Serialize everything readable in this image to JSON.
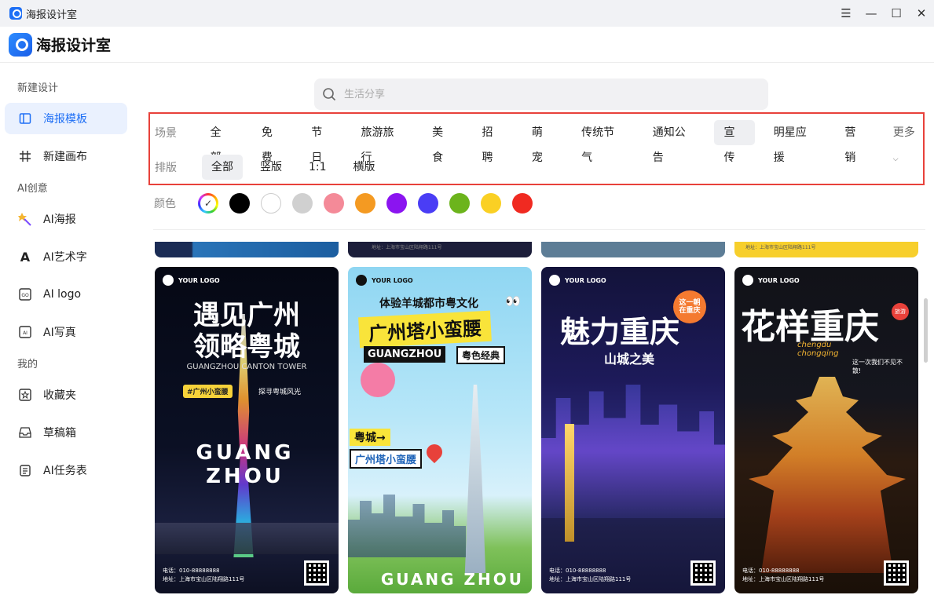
{
  "window": {
    "title": "海报设计室",
    "controls": [
      "menu-icon",
      "minimize-icon",
      "maximize-icon",
      "close-icon"
    ]
  },
  "app": {
    "title": "海报设计室"
  },
  "sidebar": {
    "sections": [
      {
        "label": "新建设计",
        "items": [
          {
            "label": "海报模板",
            "icon": "poster-template-icon",
            "active": true
          },
          {
            "label": "新建画布",
            "icon": "canvas-grid-icon",
            "active": false
          }
        ]
      },
      {
        "label": "AI创意",
        "items": [
          {
            "label": "AI海报",
            "icon": "ai-magic-wand-icon"
          },
          {
            "label": "AI艺术字",
            "icon": "ai-text-icon"
          },
          {
            "label": "AI logo",
            "icon": "ai-logo-icon"
          },
          {
            "label": "AI写真",
            "icon": "ai-portrait-icon"
          }
        ]
      },
      {
        "label": "我的",
        "items": [
          {
            "label": "收藏夹",
            "icon": "favorites-star-icon"
          },
          {
            "label": "草稿箱",
            "icon": "drafts-inbox-icon"
          },
          {
            "label": "AI任务表",
            "icon": "task-list-icon"
          }
        ]
      }
    ]
  },
  "search": {
    "placeholder": "生活分享"
  },
  "filters": {
    "scene_label": "场景",
    "scene_options": [
      "全部",
      "免费",
      "节日",
      "旅游旅行",
      "美食",
      "招聘",
      "萌宠",
      "传统节气",
      "通知公告",
      "宣传",
      "明星应援",
      "营销"
    ],
    "scene_selected": "宣传",
    "more_label": "更多",
    "layout_label": "排版",
    "layout_options": [
      "全部",
      "竖版",
      "1:1",
      "横版"
    ],
    "layout_selected": "全部",
    "color_label": "颜色",
    "colors": [
      "rainbow",
      "#000000",
      "#ffffff",
      "#d0d0d0",
      "#f48a98",
      "#f49a22",
      "#8b14f0",
      "#4a3df5",
      "#6cb41c",
      "#fad024",
      "#f02a21"
    ],
    "color_selected": "rainbow"
  },
  "posters": [
    {
      "logo": "YOUR LOGO",
      "title1": "遇见广州",
      "title2": "领略粤城",
      "subtitle": "GUANGZHOU CANTON TOWER",
      "tag": "#广州小蛮腰",
      "tag2": "探寻粤城风光",
      "big": "GUANG ZHOU",
      "phone": "电话：010-88888888",
      "addr": "地址：上海市宝山区陆翔路111号"
    },
    {
      "logo": "YOUR LOGO",
      "title1": "体验羊城都市粤文化",
      "title2": "广州塔小蛮腰",
      "subtitle": "GUANGZHOU",
      "tag": "粤色经典",
      "tag2": "粤城→",
      "tag3": "广州塔小蛮腰",
      "big": "GUANG ZHOU"
    },
    {
      "logo": "YOUR LOGO",
      "title1": "魅力重庆",
      "title2": "山城之美",
      "tag": "这一朝在重庆",
      "phone": "电话：010-88888888",
      "addr": "地址：上海市宝山区陆翔路111号"
    },
    {
      "logo": "YOUR LOGO",
      "title1": "花样重庆",
      "subtitle": "chengdu chongqing",
      "tag": "旅游",
      "tag2": "这一次我们不见不散!",
      "phone": "电话：010-88888888",
      "addr": "地址：上海市宝山区陆翔路111号"
    }
  ],
  "top_cards": {
    "addr_a": "地址：上海市宝山区陆翔路111号",
    "addr_b": "地址：上海市宝山区陆翔路111号"
  }
}
